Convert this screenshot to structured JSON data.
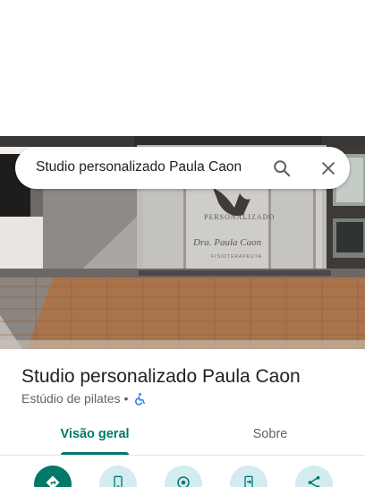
{
  "search": {
    "query": "Studio personalizado Paula Caon"
  },
  "place": {
    "name": "Studio personalizado Paula Caon",
    "category": "Estúdio de pilates",
    "separator": "•"
  },
  "tabs": [
    {
      "label": "Visão geral",
      "active": true
    },
    {
      "label": "Sobre",
      "active": false
    }
  ],
  "photo": {
    "sign_line1": "PERSONALIZADO",
    "sign_line2": "Dra. Paula Caon",
    "sign_line3": "FISIOTERAPEUTA"
  },
  "actions": [
    {
      "icon": "directions-icon"
    },
    {
      "icon": "phone-icon"
    },
    {
      "icon": "save-icon"
    },
    {
      "icon": "send-to-phone-icon"
    },
    {
      "icon": "share-icon"
    }
  ],
  "colors": {
    "accent": "#00796b",
    "action_bg": "#d2ecf0",
    "accessibility": "#1a73e8"
  }
}
